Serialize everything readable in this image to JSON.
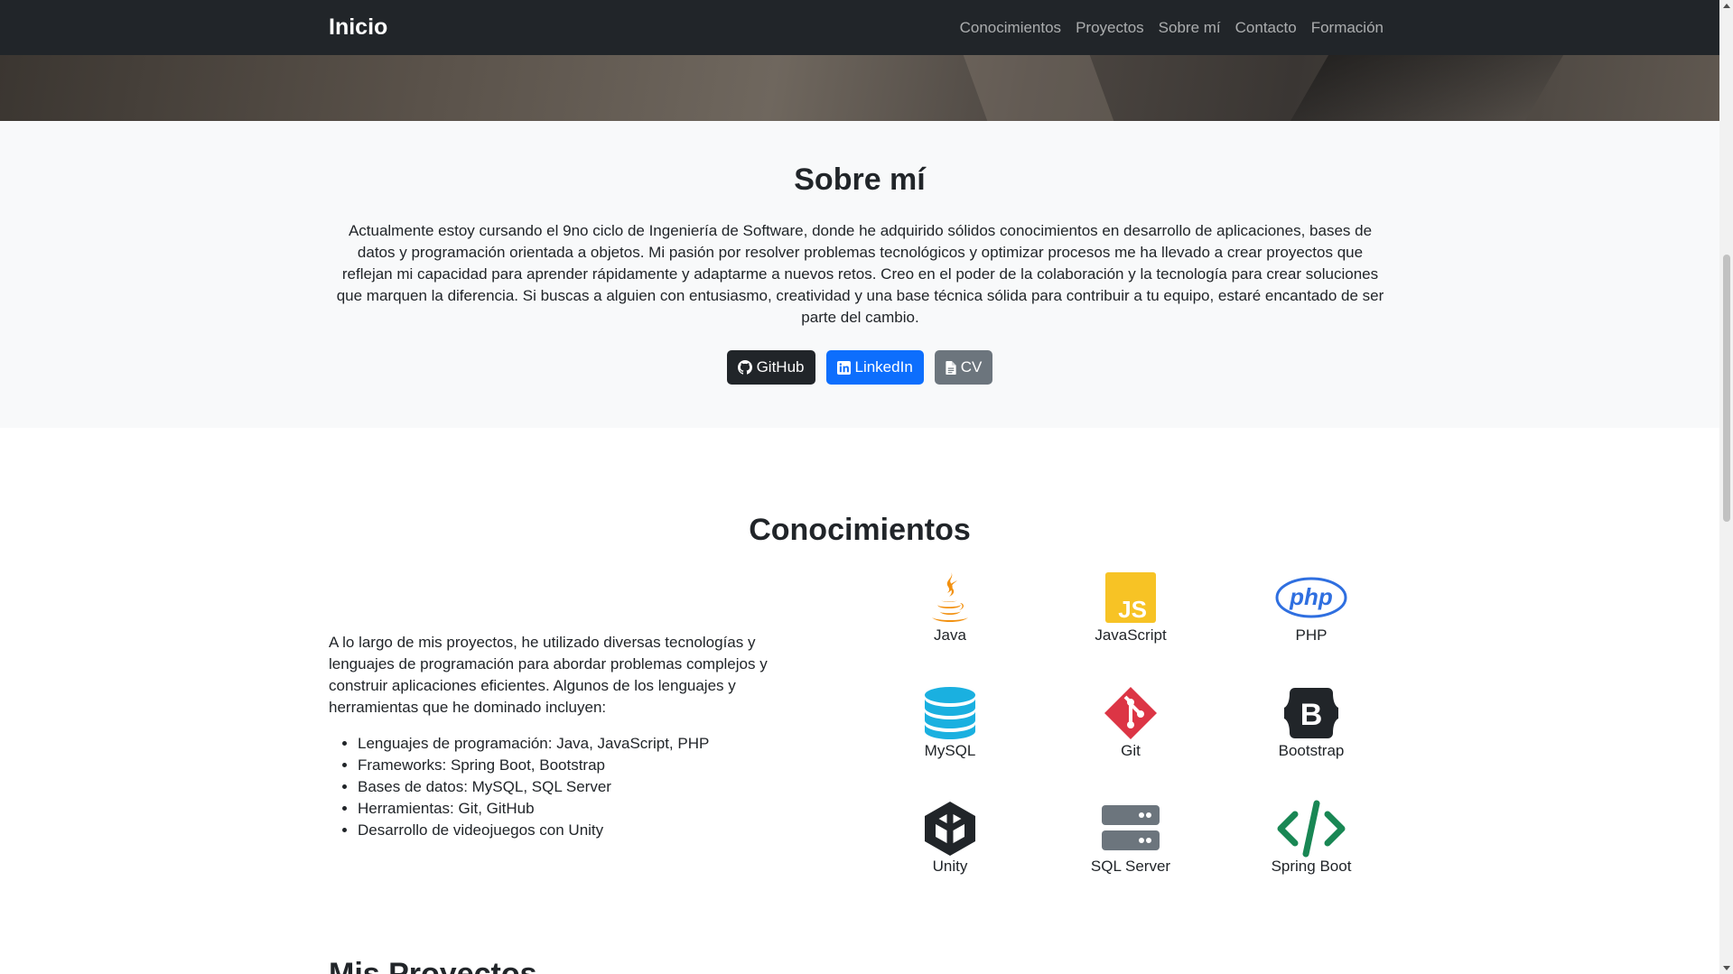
{
  "navbar": {
    "brand": "Inicio",
    "links": [
      "Conocimientos",
      "Proyectos",
      "Sobre mí",
      "Contacto",
      "Formación"
    ]
  },
  "about": {
    "title": "Sobre mí",
    "text": "Actualmente estoy cursando el 9no ciclo de Ingeniería de Software, donde he adquirido sólidos conocimientos en desarrollo de aplicaciones, bases de datos y programación orientada a objetos. Mi pasión por resolver problemas tecnológicos y optimizar procesos me ha llevado a crear proyectos que reflejan mi capacidad para aprender rápidamente y adaptarme a nuevos retos. Creo en el poder de la colaboración y la tecnología para crear soluciones que marquen la diferencia. Si buscas a alguien con entusiasmo, creatividad y una base técnica sólida para contribuir a tu equipo, estaré encantado de ser parte del cambio.",
    "buttons": {
      "github": "GitHub",
      "linkedin": "LinkedIn",
      "cv": "CV"
    }
  },
  "skills": {
    "title": "Conocimientos",
    "intro": "A lo largo de mis proyectos, he utilizado diversas tecnologías y lenguajes de programación para abordar problemas complejos y construir aplicaciones eficientes. Algunos de los lenguajes y herramientas que he dominado incluyen:",
    "list": [
      "Lenguajes de programación: Java, JavaScript, PHP",
      "Frameworks: Spring Boot, Bootstrap",
      "Bases de datos: MySQL, SQL Server",
      "Herramientas: Git, GitHub",
      "Desarrollo de videojuegos con Unity"
    ],
    "items": [
      {
        "label": "Java",
        "icon": "java-icon"
      },
      {
        "label": "JavaScript",
        "icon": "javascript-icon"
      },
      {
        "label": "PHP",
        "icon": "php-icon"
      },
      {
        "label": "MySQL",
        "icon": "mysql-icon"
      },
      {
        "label": "Git",
        "icon": "git-icon"
      },
      {
        "label": "Bootstrap",
        "icon": "bootstrap-icon"
      },
      {
        "label": "Unity",
        "icon": "unity-icon"
      },
      {
        "label": "SQL Server",
        "icon": "sql-server-icon"
      },
      {
        "label": "Spring Boot",
        "icon": "spring-boot-icon"
      }
    ]
  },
  "next_section": {
    "title": "Mis Proyectos"
  },
  "colors": {
    "navbar": "#212529",
    "primary": "#0d6efd",
    "secondary": "#6c757d",
    "section_bg": "#f8f9fa",
    "javascript": "#f7c325",
    "php": "#2f6fe0",
    "mysql": "#1ab0e0",
    "git": "#dc3545",
    "spring": "#198754"
  }
}
